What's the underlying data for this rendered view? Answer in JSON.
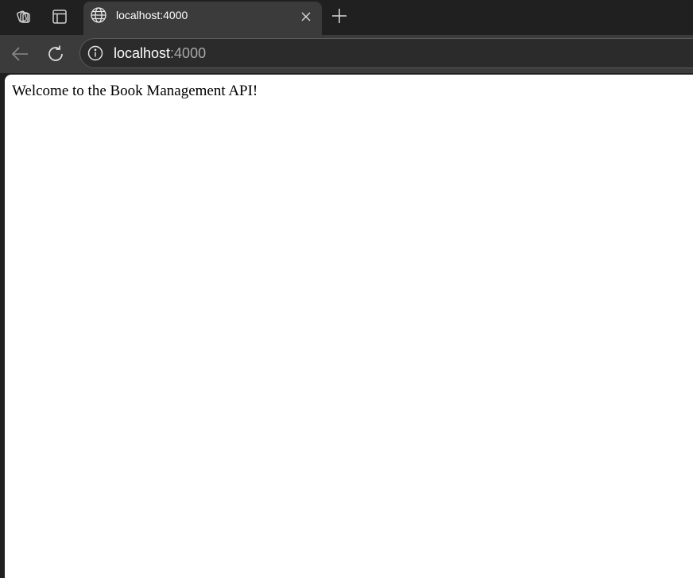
{
  "tabstrip": {
    "workspaces_icon": "workspaces-icon",
    "tab_actions_icon": "tab-actions-icon",
    "active_tab": {
      "icon": "globe-icon",
      "title": "localhost:4000",
      "close_icon": "close-icon"
    },
    "new_tab_icon": "plus-icon"
  },
  "toolbar": {
    "back_icon": "back-arrow-icon",
    "reload_icon": "reload-icon",
    "address_bar": {
      "info_icon": "info-icon",
      "host": "localhost",
      "port": ":4000"
    }
  },
  "page": {
    "body_text": "Welcome to the Book Management API!"
  },
  "colors": {
    "tabstrip_bg": "#202020",
    "toolbar_bg": "#3b3b3b",
    "page_bg": "#ffffff"
  }
}
